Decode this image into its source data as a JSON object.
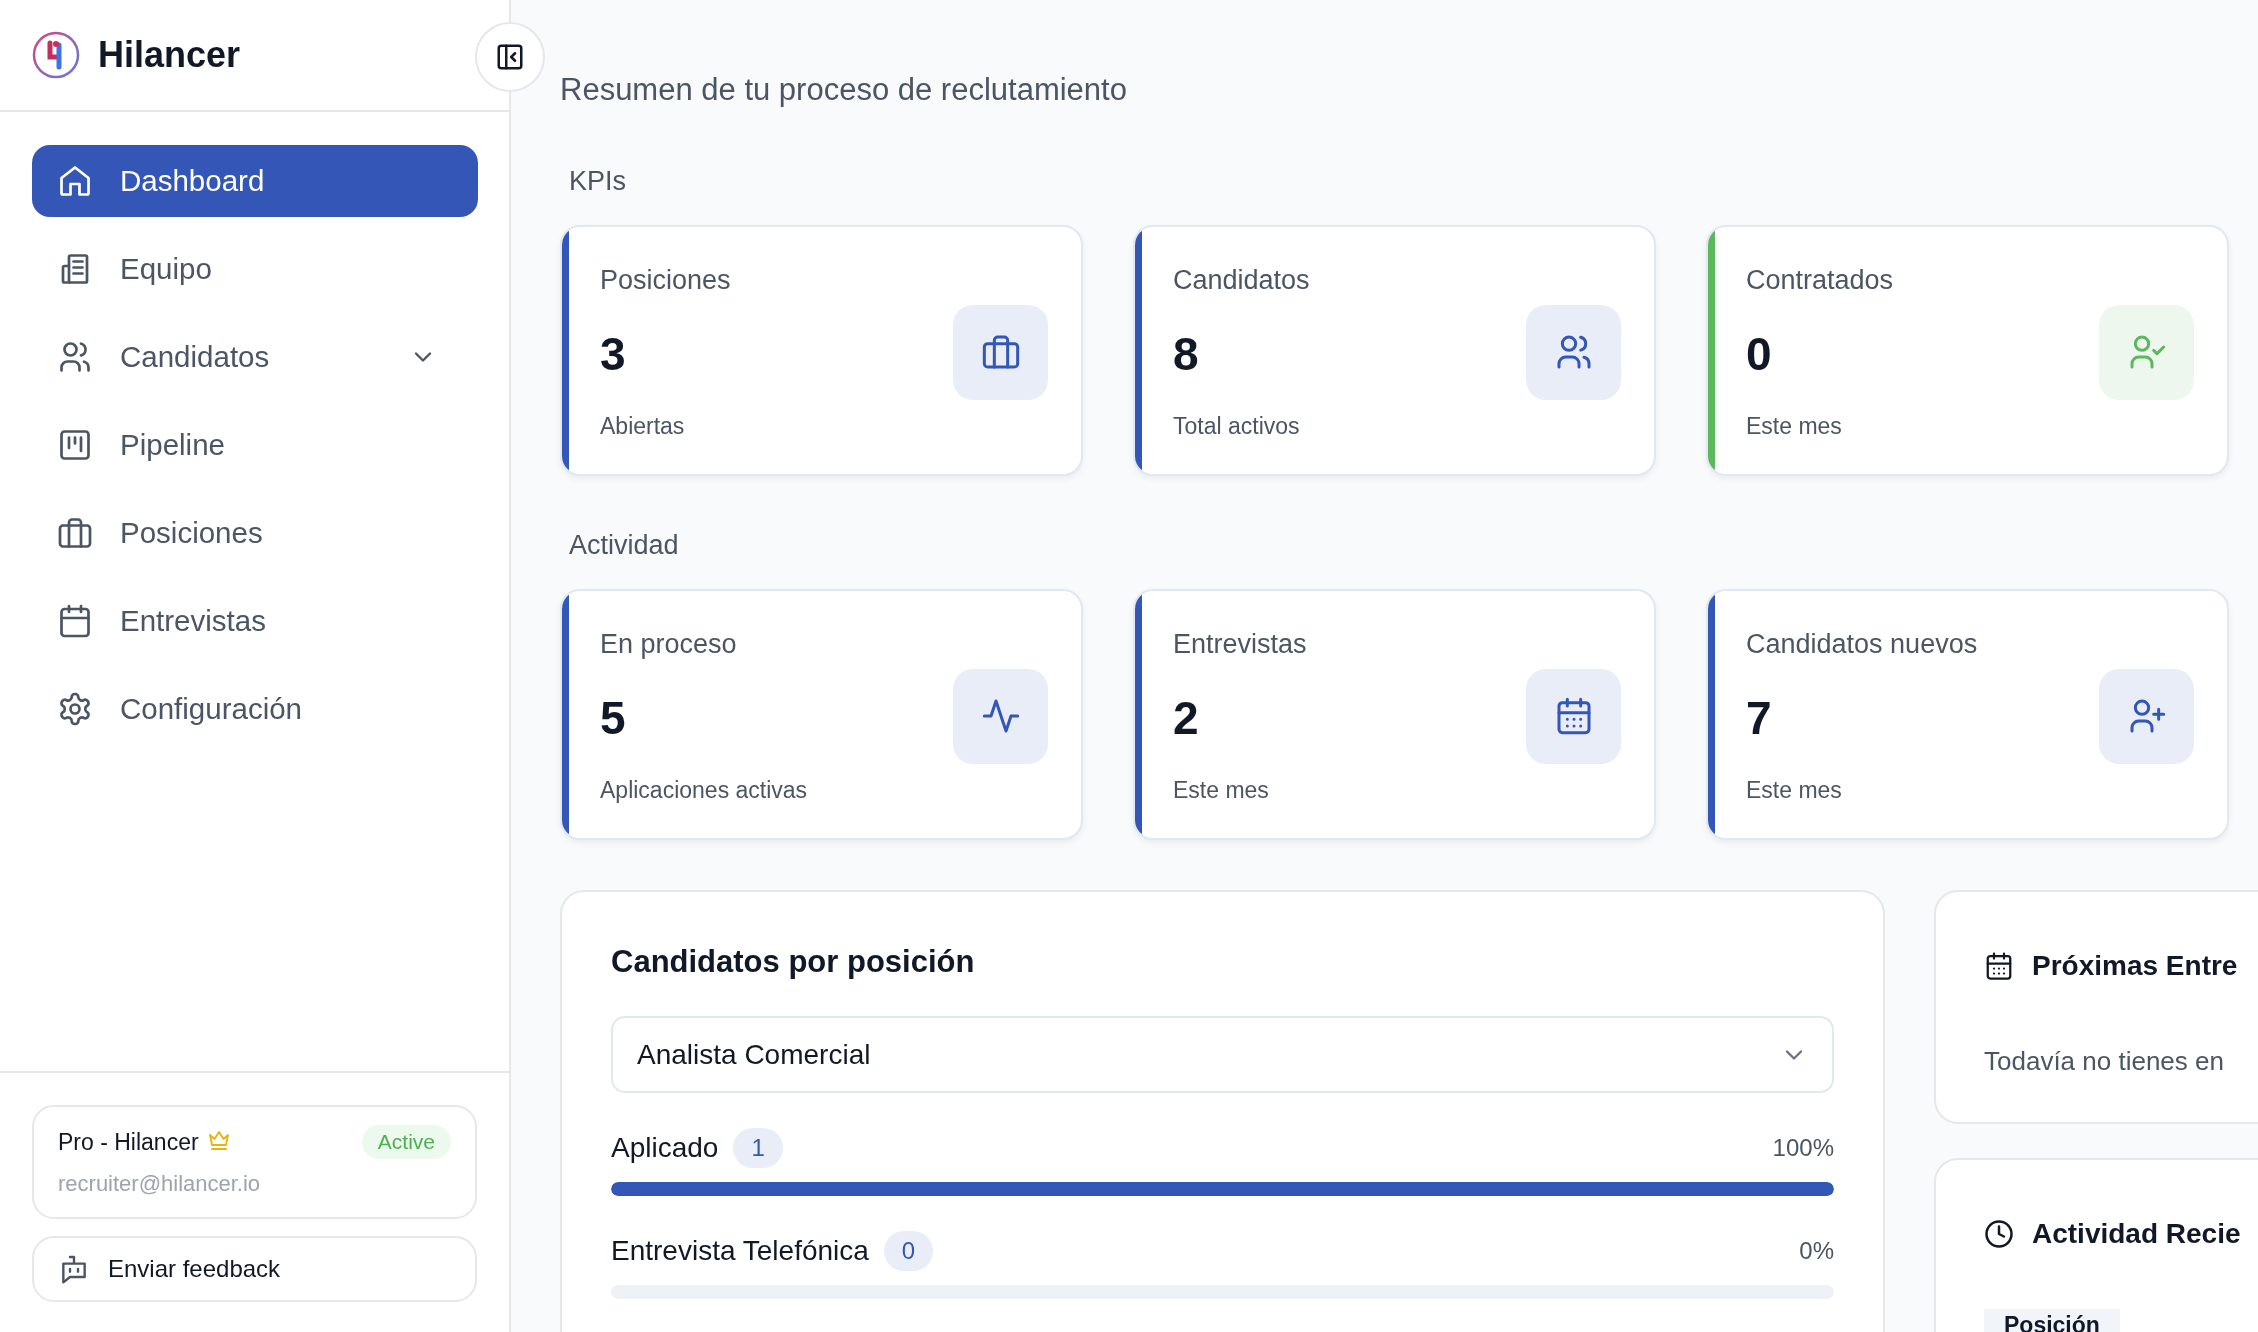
{
  "brand": {
    "name": "Hilancer"
  },
  "sidebar": {
    "items": [
      {
        "label": "Dashboard",
        "selected": true
      },
      {
        "label": "Equipo",
        "selected": false
      },
      {
        "label": "Candidatos",
        "selected": false,
        "expanded": false
      },
      {
        "label": "Pipeline",
        "selected": false
      },
      {
        "label": "Posiciones",
        "selected": false
      },
      {
        "label": "Entrevistas",
        "selected": false
      },
      {
        "label": "Configuración",
        "selected": false
      }
    ]
  },
  "plan": {
    "name": "Pro - Hilancer",
    "status": "Active",
    "email": "recruiter@hilancer.io"
  },
  "feedback_button": "Enviar feedback",
  "page_subtitle": "Resumen de tu proceso de reclutamiento",
  "sections": [
    {
      "title": "KPIs",
      "cards": [
        {
          "label": "Posiciones",
          "value": "3",
          "caption": "Abiertas",
          "color": "#3457b7"
        },
        {
          "label": "Candidatos",
          "value": "8",
          "caption": "Total activos",
          "color": "#3457b7"
        },
        {
          "label": "Contratados",
          "value": "0",
          "caption": "Este mes",
          "color": "#5cb85c"
        }
      ]
    },
    {
      "title": "Actividad",
      "cards": [
        {
          "label": "En proceso",
          "value": "5",
          "caption": "Aplicaciones activas",
          "color": "#3457b7"
        },
        {
          "label": "Entrevistas",
          "value": "2",
          "caption": "Este mes",
          "color": "#3457b7"
        },
        {
          "label": "Candidatos nuevos",
          "value": "7",
          "caption": "Este mes",
          "color": "#3457b7"
        }
      ]
    }
  ],
  "candidates_by_position": {
    "title": "Candidatos por posición",
    "select": {
      "value": "Analista Comercial"
    },
    "stages": [
      {
        "name": "Aplicado",
        "count": "1",
        "percent": "100%",
        "level": 1
      },
      {
        "name": "Entrevista Telefónica",
        "count": "0",
        "percent": "0%",
        "level": 0
      }
    ]
  },
  "upcoming_interviews": {
    "title": "Próximas Entre",
    "message": "Todavía no tienes en"
  },
  "recent_activity": {
    "title": "Actividad Recie",
    "columns": [
      "Posición"
    ]
  }
}
